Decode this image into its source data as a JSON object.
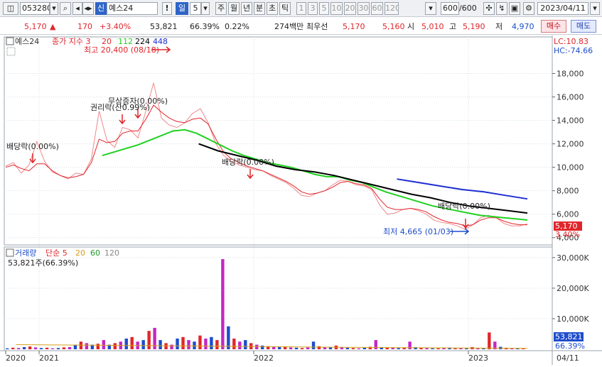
{
  "toolbar": {
    "code": "053280",
    "mode_badge": "신",
    "name": "예스24",
    "bang": "!",
    "period_selected": "일",
    "period_num": "5",
    "periods": [
      "주",
      "월",
      "년",
      "분",
      "초",
      "틱"
    ],
    "ranges": [
      "1",
      "3",
      "5",
      "10",
      "20",
      "30",
      "60",
      "120"
    ],
    "count": "600",
    "count_total": "/600",
    "date": "2023/04/11"
  },
  "info": {
    "price": "5,170",
    "change": "170",
    "change_pct": "+3.40%",
    "volume": "53,821",
    "ratio": "66.39%",
    "turnover": "0.22%",
    "amount": "274백만",
    "bid_label": "최우선",
    "bid1": "5,170",
    "bid2": "5,160",
    "open_label": "시",
    "open": "5,010",
    "high_label": "고",
    "high": "5,190",
    "low_label": "저",
    "low": "4,970",
    "buy_label": "매수",
    "sell_label": "매도"
  },
  "price_panel": {
    "name_tag": "예스24",
    "legend_prefix": "종가 지수 3",
    "ma": [
      {
        "label": "20",
        "color": "#e0262b"
      },
      {
        "label": "112",
        "color": "#1fd11f"
      },
      {
        "label": "224",
        "color": "#000000"
      },
      {
        "label": "448",
        "color": "#1d2fd1"
      }
    ],
    "lc": "LC:10.83",
    "hc": "HC:-74.66",
    "high_note": "최고 20,400 (08/18)",
    "low_note": "최저 4,665 (01/03)",
    "events": [
      {
        "label": "배당락(0.00%)"
      },
      {
        "label": "권리락(산0.99%)"
      },
      {
        "label": "무상증자(0.00%)"
      },
      {
        "label": "배당락(0.00%)"
      },
      {
        "label": "배당락(0.00%)"
      }
    ],
    "cur_price_tag": "5,170",
    "cur_pct_tag": "3.40%"
  },
  "volume_panel": {
    "legend_label": "거래량",
    "legend_prefix": "단순 5",
    "ma": [
      {
        "label": "20",
        "color": "#d4a017"
      },
      {
        "label": "60",
        "color": "#1d9a2a"
      },
      {
        "label": "120",
        "color": "#888888"
      }
    ],
    "value_note": "53,821주(66.39%)",
    "cur_vol_tag": "53,821",
    "cur_pct_tag": "66.39%"
  },
  "x_axis": {
    "ticks": [
      "2020",
      "2021",
      "2022",
      "2023"
    ],
    "right_label": "04/11"
  },
  "chart_data": {
    "type": "line",
    "title": "",
    "price_axis": {
      "ticks": [
        4000,
        6000,
        8000,
        10000,
        12000,
        14000,
        16000,
        18000
      ],
      "tick_labels": [
        "4,000",
        "6,000",
        "8,000",
        "10,000",
        "12,000",
        "14,000",
        "16,000",
        "18,000"
      ],
      "range": [
        3500,
        21000
      ]
    },
    "volume_axis": {
      "ticks": [
        10000,
        20000,
        30000
      ],
      "tick_labels": [
        "10,000K",
        "20,000K",
        "30,000K"
      ],
      "range": [
        0,
        33000
      ]
    },
    "series": [
      {
        "name": "종가",
        "color": "#e0262b",
        "values": [
          10100,
          10400,
          9500,
          10200,
          12200,
          10500,
          9600,
          9300,
          9000,
          9500,
          9400,
          10700,
          14800,
          12300,
          11700,
          13400,
          13200,
          12500,
          14800,
          17200,
          14200,
          13600,
          13400,
          13800,
          14600,
          15000,
          13800,
          12000,
          11000,
          10500,
          10200,
          10000,
          9800,
          9700,
          9300,
          9000,
          8700,
          8200,
          7600,
          7500,
          7800,
          8000,
          8500,
          8900,
          8800,
          8500,
          8400,
          8100,
          6800,
          6000,
          6100,
          6400,
          6500,
          6300,
          6000,
          5500,
          5300,
          5200,
          5000,
          4700,
          5100,
          5700,
          5900,
          5700,
          5200,
          5000,
          5000,
          5170
        ]
      },
      {
        "name": "20",
        "color": "#e0262b",
        "values": [
          10000,
          10200,
          9900,
          9700,
          10300,
          10300,
          9700,
          9300,
          9100,
          9200,
          9400,
          10400,
          12400,
          12100,
          12200,
          12900,
          13100,
          13100,
          14100,
          15300,
          14700,
          14200,
          13900,
          13800,
          14100,
          14200,
          13700,
          12400,
          11300,
          10700,
          10400,
          10100,
          9900,
          9700,
          9400,
          9100,
          8800,
          8400,
          7900,
          7700,
          7800,
          8000,
          8300,
          8700,
          8800,
          8600,
          8500,
          8200,
          7300,
          6600,
          6400,
          6400,
          6500,
          6400,
          6200,
          5800,
          5500,
          5300,
          5200,
          5000,
          5100,
          5500,
          5700,
          5700,
          5400,
          5200,
          5100,
          5100
        ]
      },
      {
        "name": "112",
        "color": "#1fd11f",
        "values": [
          11000,
          11300,
          11600,
          11900,
          12300,
          12700,
          13100,
          13200,
          12900,
          12400,
          11900,
          11400,
          11000,
          10700,
          10400,
          10200,
          10000,
          9700,
          9400,
          9200,
          9200,
          8900,
          8700,
          8300,
          7900,
          7600,
          7300,
          7000,
          6700,
          6500,
          6300,
          6100,
          5900,
          5800,
          5700,
          5600,
          5500
        ]
      },
      {
        "name": "224",
        "color": "#000000",
        "values": [
          12000,
          11400,
          11000,
          10600,
          10100,
          9800,
          9600,
          9300,
          8900,
          8500,
          8100,
          7700,
          7400,
          7000,
          6700,
          6500,
          6300,
          6100
        ]
      },
      {
        "name": "448",
        "color": "#1d2fd1",
        "values": [
          9000,
          8700,
          8400,
          8100,
          7900,
          7600,
          7300
        ]
      }
    ],
    "volume_values": [
      300,
      500,
      400,
      700,
      900,
      600,
      400,
      500,
      300,
      400,
      600,
      700,
      1500,
      2500,
      2000,
      1500,
      1800,
      3000,
      1500,
      2000,
      2500,
      3500,
      4000,
      2500,
      3000,
      6000,
      7000,
      3000,
      2000,
      1500,
      3500,
      4000,
      3000,
      2500,
      4500,
      3500,
      4000,
      3000,
      29500,
      7500,
      3500,
      2500,
      3000,
      2000,
      1500,
      1200,
      1000,
      800,
      700,
      900,
      600,
      500,
      400,
      600,
      2500,
      1000,
      800,
      600,
      1200,
      700,
      500,
      400,
      300,
      500,
      800,
      3000,
      700,
      600,
      500,
      400,
      600,
      2500,
      700,
      500,
      400,
      300,
      300,
      400,
      500,
      300,
      400,
      300,
      700,
      400,
      300,
      5500,
      2500,
      800,
      500,
      400,
      300,
      300
    ]
  }
}
